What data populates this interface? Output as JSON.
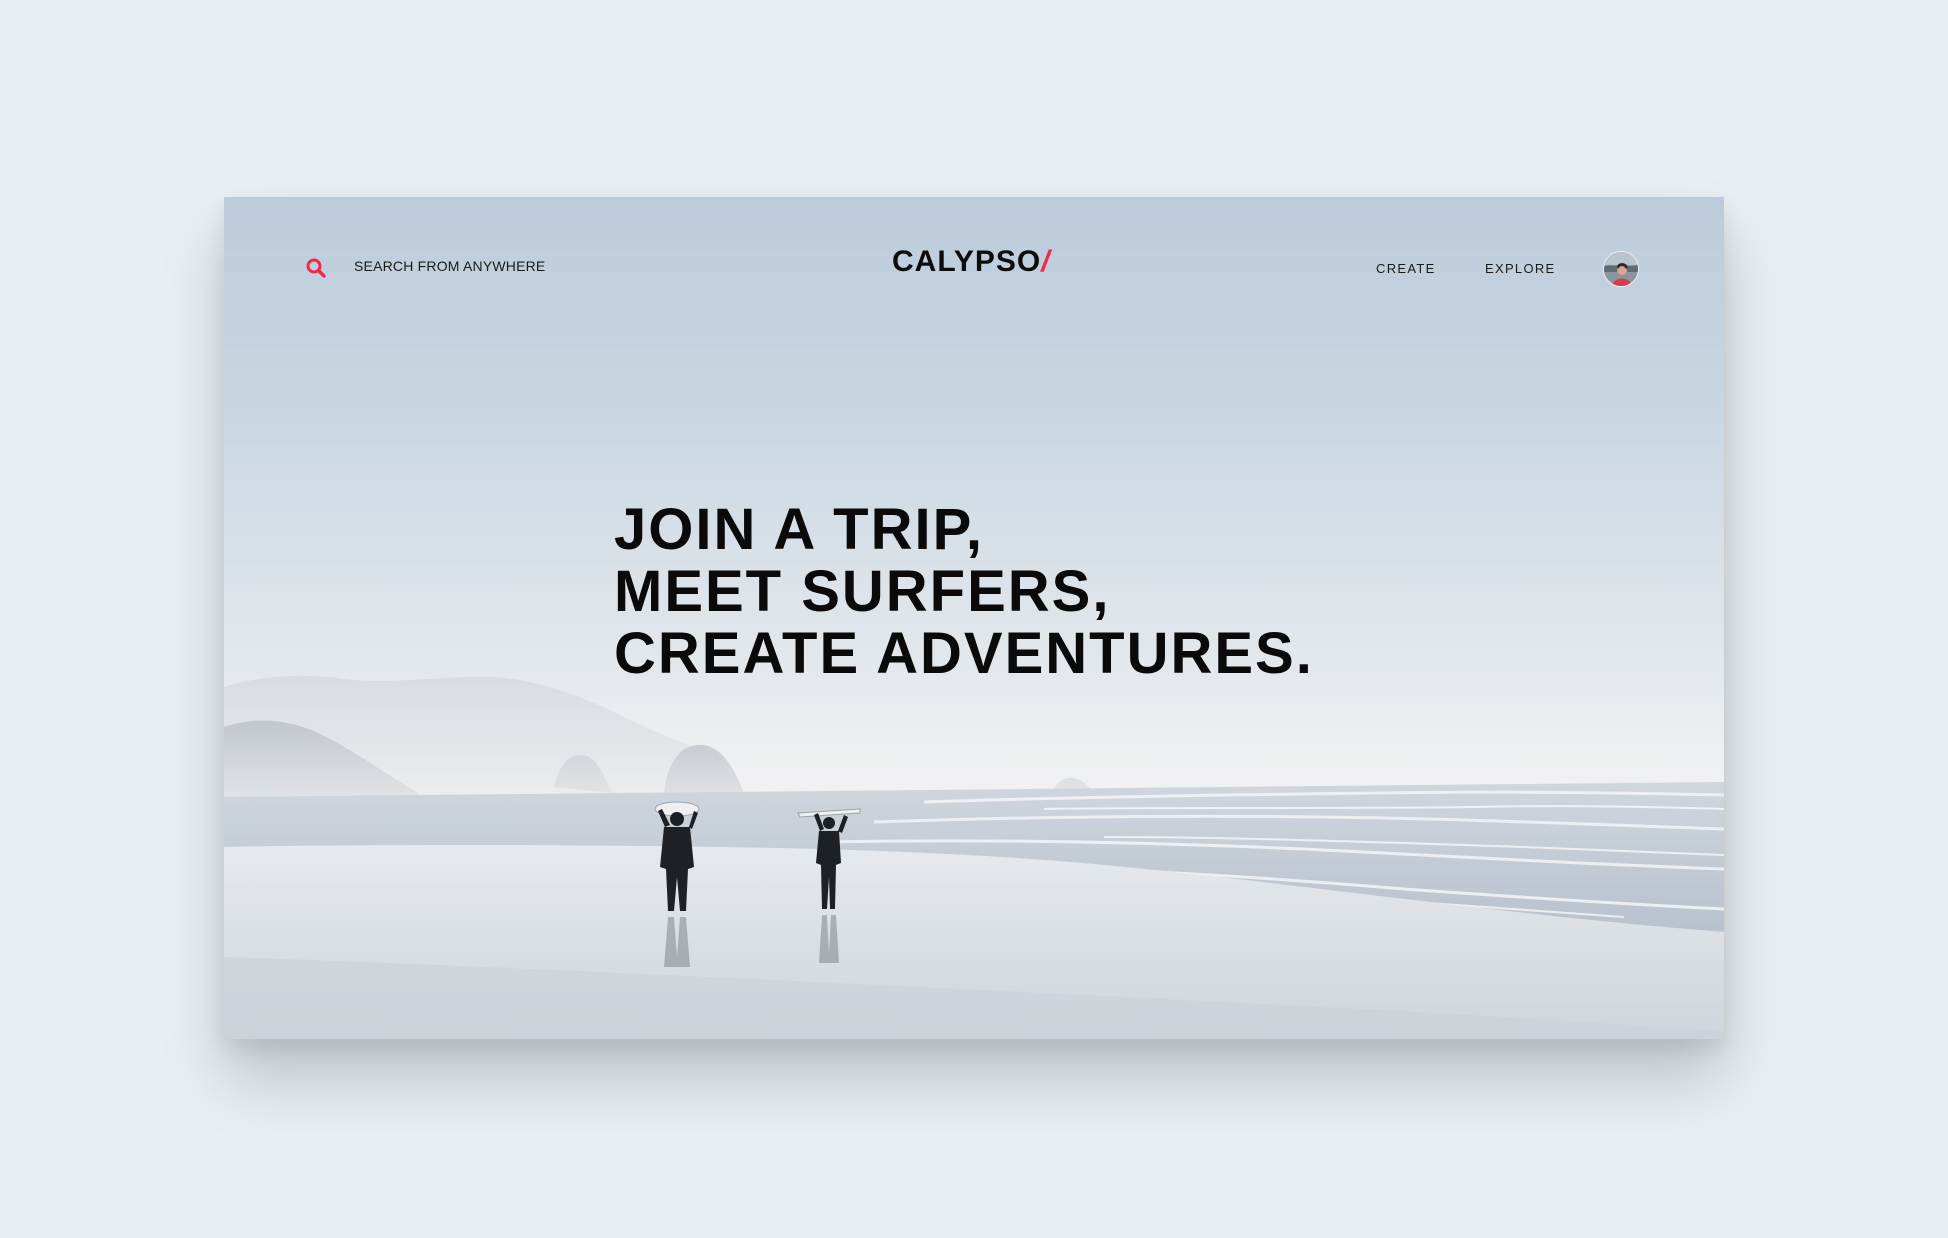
{
  "header": {
    "search_label": "SEARCH FROM ANYWHERE",
    "logo_text": "CALYPSO",
    "logo_mark": "/",
    "nav": {
      "create": "CREATE",
      "explore": "EXPLORE"
    }
  },
  "hero": {
    "line1": "JOIN A TRIP,",
    "line2": "MEET SURFERS,",
    "line3": "CREATE ADVENTURES."
  },
  "icons": {
    "search": "search-icon",
    "avatar": "user-avatar"
  },
  "colors": {
    "accent": "#ee2b4a",
    "text": "#0a0a0a",
    "page_background": "#e9eef2"
  }
}
